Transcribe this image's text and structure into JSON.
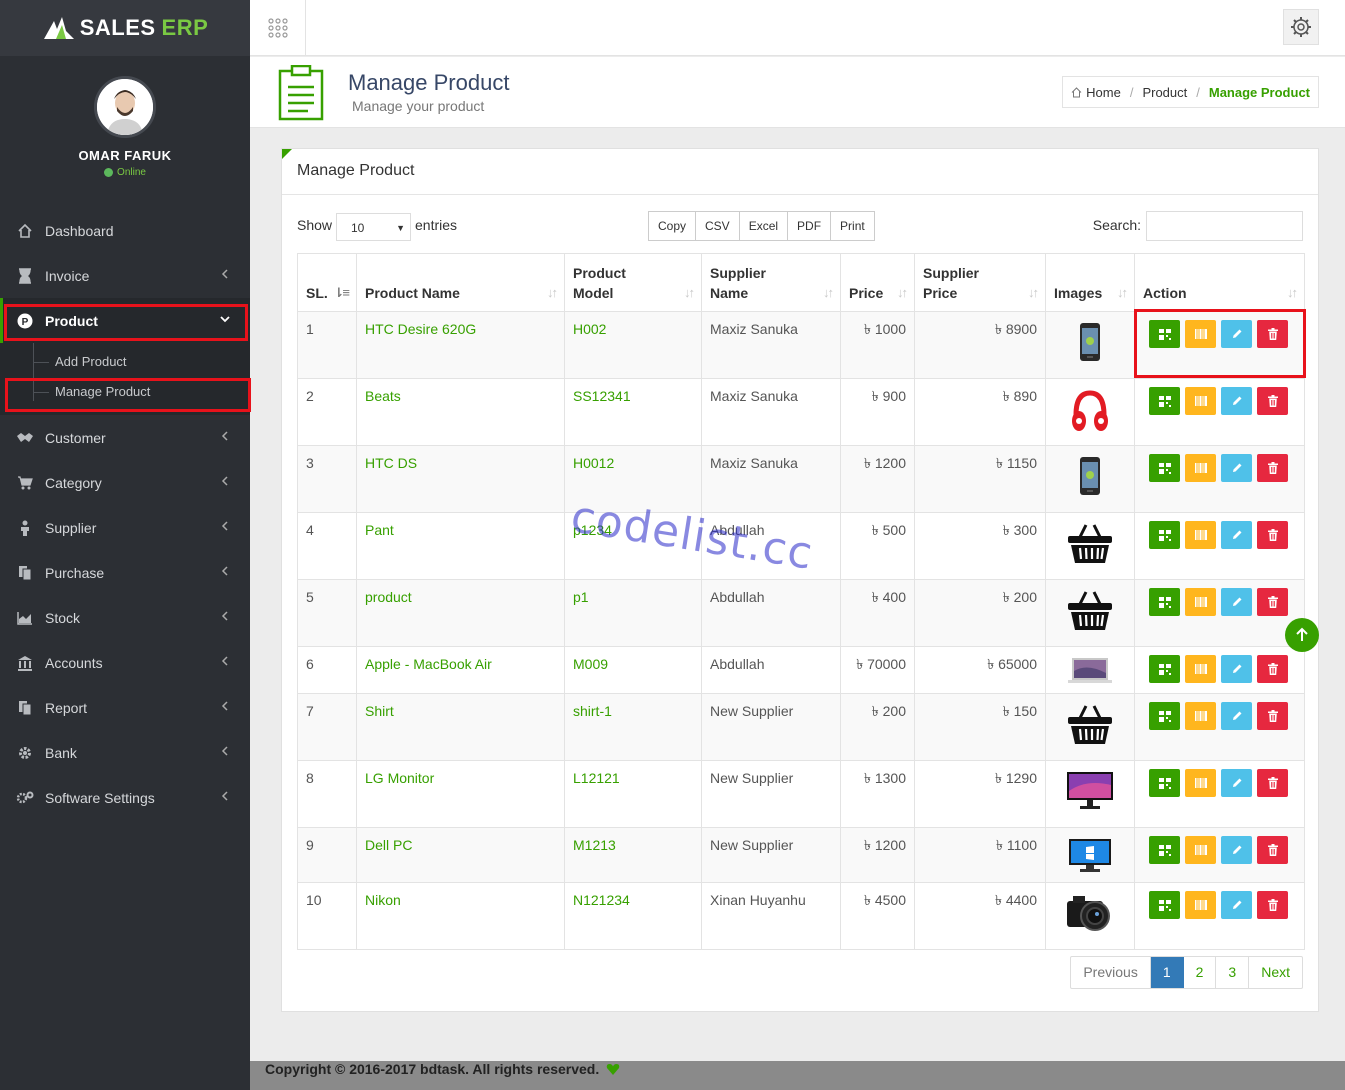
{
  "app": {
    "logo_main": "SALES",
    "logo_accent": "ERP"
  },
  "user": {
    "name": "OMAR FARUK",
    "status": "Online"
  },
  "sidebar": {
    "items": [
      {
        "label": "Dashboard",
        "icon": "home-icon"
      },
      {
        "label": "Invoice",
        "icon": "hourglass-icon"
      },
      {
        "label": "Product",
        "icon": "product-p-icon"
      },
      {
        "label": "Customer",
        "icon": "handshake-icon"
      },
      {
        "label": "Category",
        "icon": "cart-icon"
      },
      {
        "label": "Supplier",
        "icon": "person-icon"
      },
      {
        "label": "Purchase",
        "icon": "copy-icon"
      },
      {
        "label": "Stock",
        "icon": "area-chart-icon"
      },
      {
        "label": "Accounts",
        "icon": "bank-icon"
      },
      {
        "label": "Report",
        "icon": "copy-icon"
      },
      {
        "label": "Bank",
        "icon": "gear-icon"
      },
      {
        "label": "Software Settings",
        "icon": "gears-icon"
      }
    ],
    "product_sub": [
      "Add Product",
      "Manage Product"
    ]
  },
  "header": {
    "title": "Manage Product",
    "subtitle": "Manage your product"
  },
  "breadcrumb": {
    "home": "Home",
    "section": "Product",
    "current": "Manage Product"
  },
  "panel": {
    "title": "Manage Product",
    "show_label": "Show",
    "page_length": "10",
    "entries_label": "entries",
    "export_buttons": [
      "Copy",
      "CSV",
      "Excel",
      "PDF",
      "Print"
    ],
    "search_label": "Search:"
  },
  "table": {
    "headers": {
      "sl": "SL.",
      "name": "Product Name",
      "model_1": "Product",
      "model_2": "Model",
      "supplier_1": "Supplier",
      "supplier_2": "Name",
      "price": "Price",
      "sprice_1": "Supplier",
      "sprice_2": "Price",
      "images": "Images",
      "action": "Action"
    },
    "rows": [
      {
        "sl": "1",
        "name": "HTC Desire 620G",
        "model": "H002",
        "supplier": "Maxiz Sanuka",
        "price": "৳ 1000",
        "supplier_price": "৳ 8900",
        "image": "phone"
      },
      {
        "sl": "2",
        "name": "Beats",
        "model": "SS12341",
        "supplier": "Maxiz Sanuka",
        "price": "৳ 900",
        "supplier_price": "৳ 890",
        "image": "headphones"
      },
      {
        "sl": "3",
        "name": "HTC DS",
        "model": "H0012",
        "supplier": "Maxiz Sanuka",
        "price": "৳ 1200",
        "supplier_price": "৳ 1150",
        "image": "phone"
      },
      {
        "sl": "4",
        "name": "Pant",
        "model": "p1234",
        "supplier": "Abdullah",
        "price": "৳ 500",
        "supplier_price": "৳ 300",
        "image": "basket"
      },
      {
        "sl": "5",
        "name": "product",
        "model": "p1",
        "supplier": "Abdullah",
        "price": "৳ 400",
        "supplier_price": "৳ 200",
        "image": "basket"
      },
      {
        "sl": "6",
        "name": "Apple - MacBook Air",
        "model": "M009",
        "supplier": "Abdullah",
        "price": "৳ 70000",
        "supplier_price": "৳ 65000",
        "image": "laptop"
      },
      {
        "sl": "7",
        "name": "Shirt",
        "model": "shirt-1",
        "supplier": "New Supplier",
        "price": "৳ 200",
        "supplier_price": "৳ 150",
        "image": "basket"
      },
      {
        "sl": "8",
        "name": "LG Monitor",
        "model": "L12121",
        "supplier": "New Supplier",
        "price": "৳ 1300",
        "supplier_price": "৳ 1290",
        "image": "monitor"
      },
      {
        "sl": "9",
        "name": "Dell PC",
        "model": "M1213",
        "supplier": "New Supplier",
        "price": "৳ 1200",
        "supplier_price": "৳ 1100",
        "image": "desktop"
      },
      {
        "sl": "10",
        "name": "Nikon",
        "model": "N121234",
        "supplier": "Xinan Huyanhu",
        "price": "৳ 4500",
        "supplier_price": "৳ 4400",
        "image": "camera"
      }
    ]
  },
  "pagination": {
    "prev": "Previous",
    "pages": [
      "1",
      "2",
      "3"
    ],
    "active": "1",
    "next": "Next"
  },
  "footer": {
    "text": "Copyright © 2016-2017 bdtask. All rights reserved."
  },
  "watermark": "codelist.cc",
  "colors": {
    "accent": "#37a000",
    "sidebar": "#2c2f34",
    "highlight": "#e8121b"
  }
}
